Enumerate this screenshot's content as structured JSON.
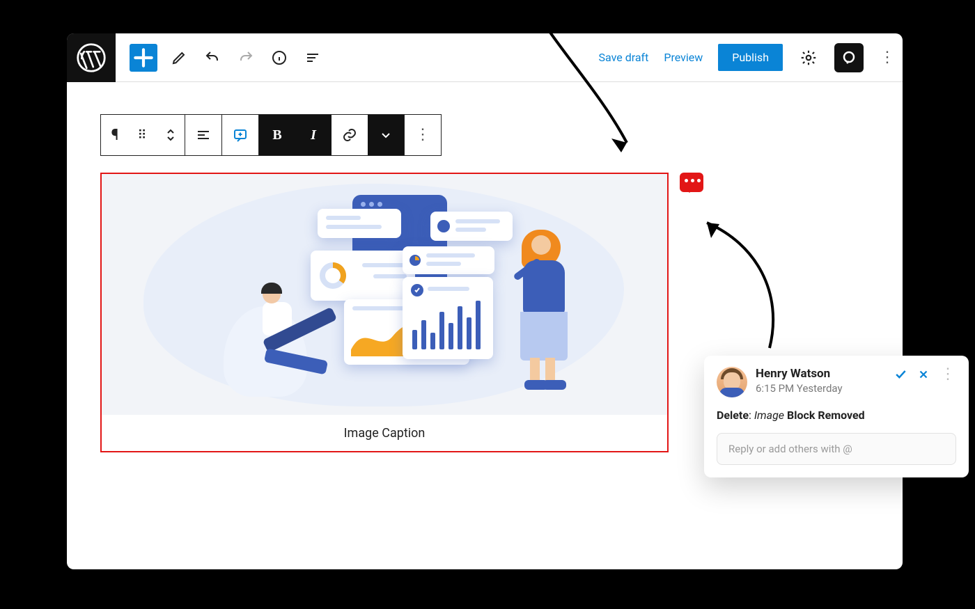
{
  "topbar": {
    "save_draft": "Save draft",
    "preview": "Preview",
    "publish": "Publish"
  },
  "block_toolbar": {
    "bold": "B",
    "italic": "I"
  },
  "image_block": {
    "caption": "Image Caption"
  },
  "comment_popup": {
    "author": "Henry Watson",
    "timestamp": "6:15 PM Yesterday",
    "action_word": "Delete",
    "sep": ": ",
    "block_type": "Image",
    "suffix": " Block Removed",
    "reply_placeholder": "Reply or add others with @"
  }
}
